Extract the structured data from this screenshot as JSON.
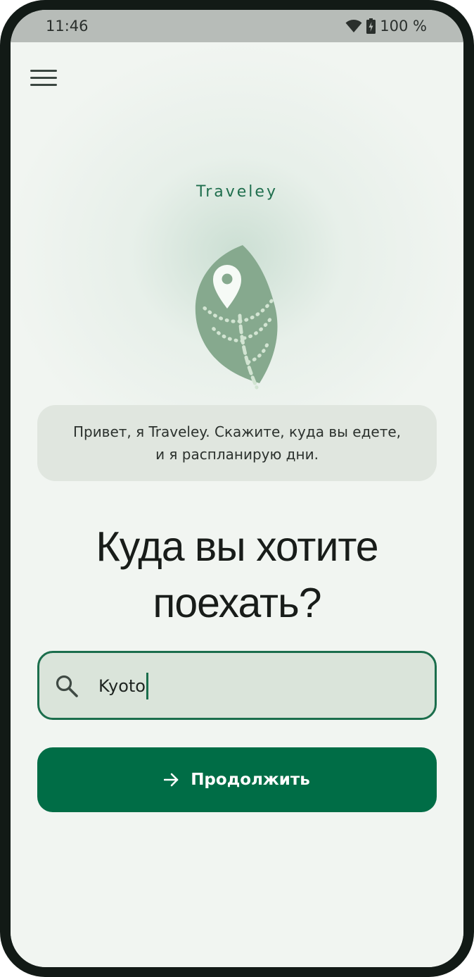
{
  "status_bar": {
    "time": "11:46",
    "battery": "100 %",
    "wifi_icon": "wifi-icon",
    "battery_icon": "battery-charging-icon"
  },
  "header": {
    "menu_icon": "hamburger-menu-icon"
  },
  "brand": {
    "name": "Traveley",
    "logo_icon": "leaf-location-pin-icon",
    "accent_color": "#006d46"
  },
  "greeting": {
    "text": "Привет, я Traveley. Скажите, куда вы едете, и я распланирую дни."
  },
  "main": {
    "title": "Куда вы хотите поехать?"
  },
  "search": {
    "icon": "search-icon",
    "value": "Kyoto"
  },
  "continue_button": {
    "icon": "arrow-right-icon",
    "label": "Продолжить"
  }
}
